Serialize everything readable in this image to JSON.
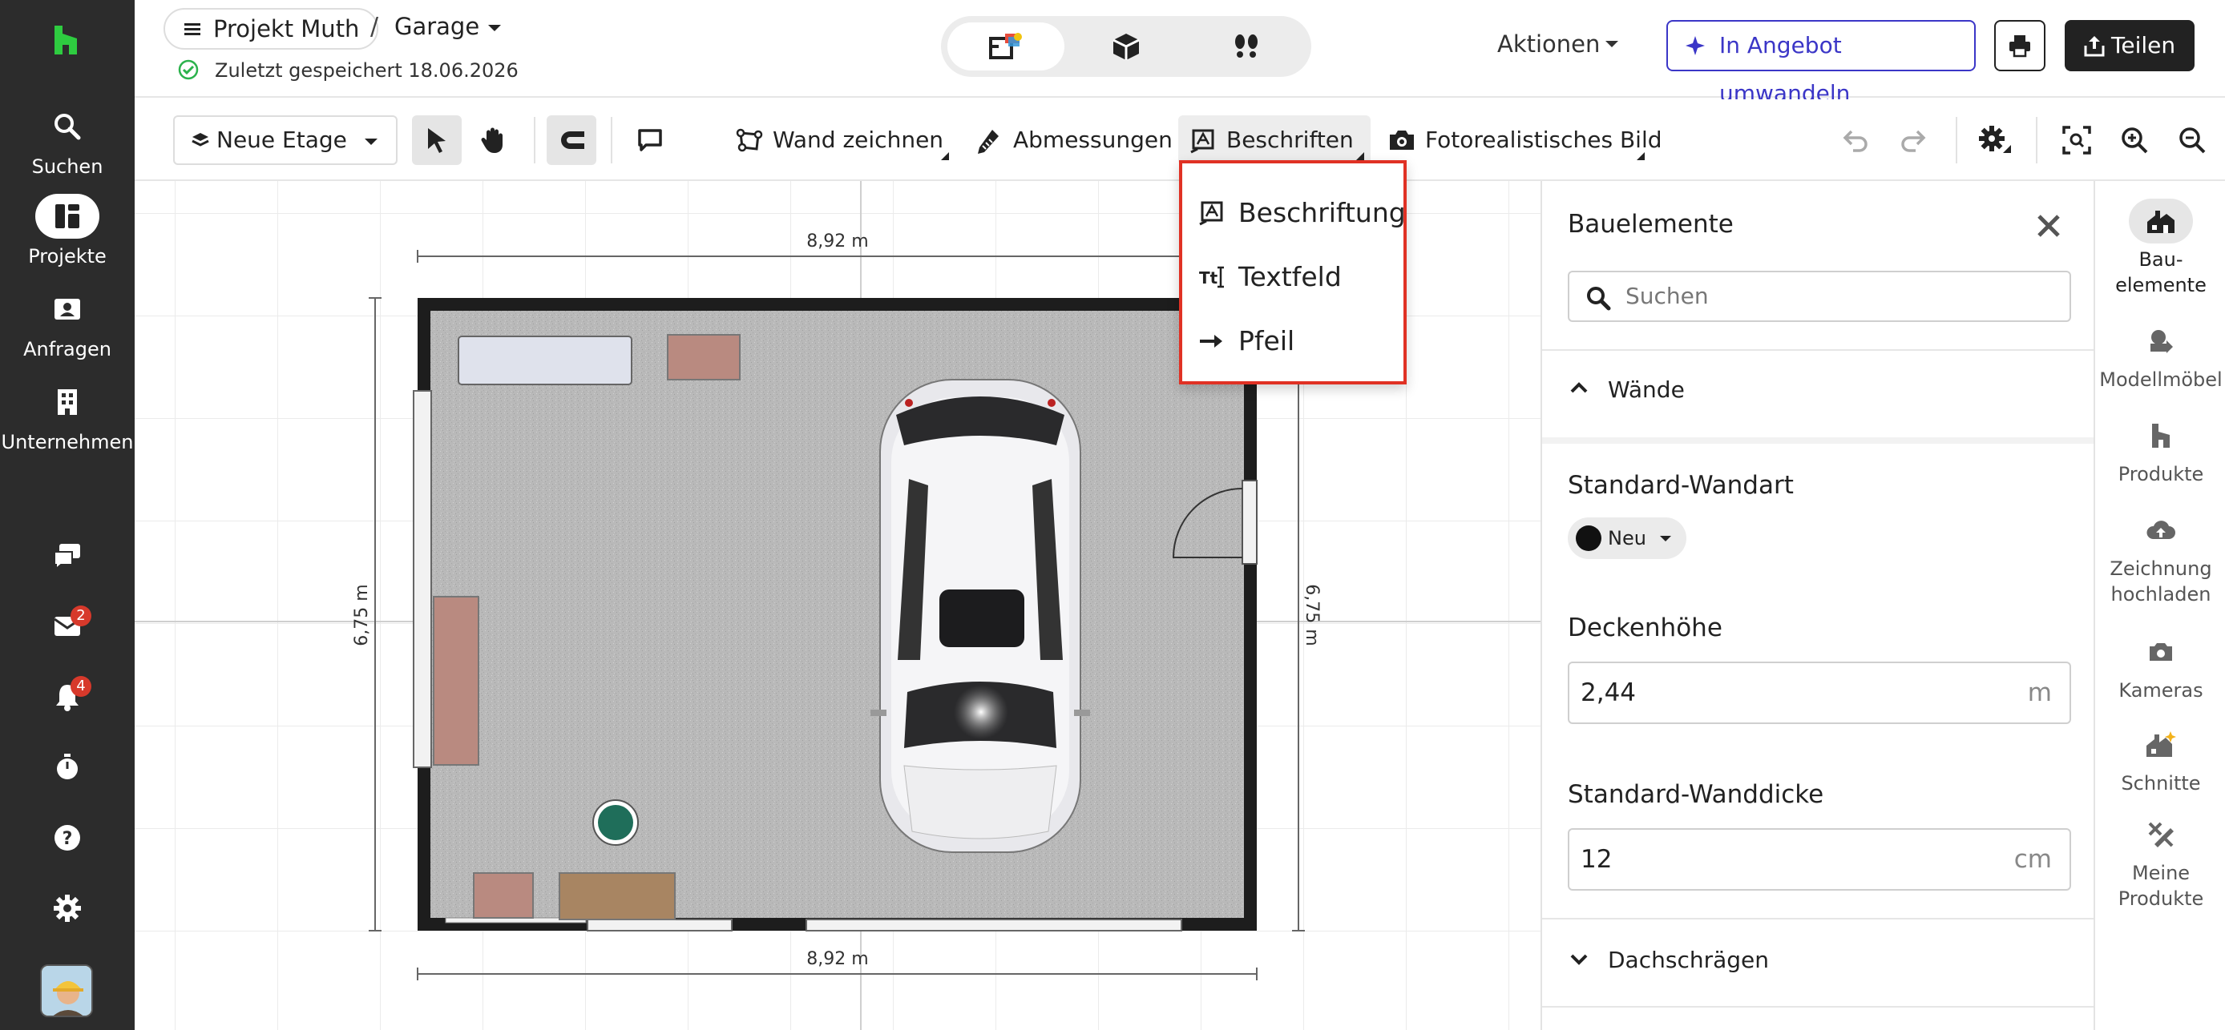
{
  "colors": {
    "nav_bg": "#2c2c2c",
    "logo": "#2ecc40",
    "accent": "#3b36c7",
    "highlight_border": "#e03124",
    "badge": "#d7392b"
  },
  "nav": {
    "logo_icon": "houzz-logo-icon",
    "items": [
      {
        "label": "Suchen",
        "icon": "search-icon"
      },
      {
        "label": "Projekte",
        "icon": "projects-icon"
      },
      {
        "label": "Anfragen",
        "icon": "inquiries-icon"
      },
      {
        "label": "Unternehmen",
        "icon": "company-icon"
      }
    ],
    "bottom": [
      {
        "icon": "chat-icon"
      },
      {
        "icon": "mail-icon",
        "badge": "2"
      },
      {
        "icon": "bell-icon",
        "badge": "4"
      },
      {
        "icon": "timer-icon"
      },
      {
        "icon": "help-icon"
      },
      {
        "icon": "settings-icon"
      }
    ]
  },
  "header": {
    "project": "Projekt Muth",
    "separator": "/",
    "room": "Garage",
    "saved": "Zuletzt gespeichert 18.06.2026",
    "views": [
      "2d-plan-icon",
      "3d-box-icon",
      "walkthrough-icon"
    ],
    "actions_label": "Aktionen",
    "convert_label": "In Angebot umwandeln",
    "share_label": "Teilen"
  },
  "toolbar": {
    "floor_label": "Neue Etage",
    "wall_label": "Wand zeichnen",
    "dimensions_label": "Abmessungen",
    "label_tool": "Beschriften",
    "photo_label": "Fotorealistisches Bild"
  },
  "dropdown": {
    "items": [
      {
        "label": "Beschriftung",
        "icon": "label-icon"
      },
      {
        "label": "Textfeld",
        "icon": "textfield-icon"
      },
      {
        "label": "Pfeil",
        "icon": "arrow-icon"
      }
    ]
  },
  "plan": {
    "dim_top": "8,92 m",
    "dim_bottom": "8,92 m",
    "dim_left": "6,75 m",
    "dim_right": "6,75 m"
  },
  "panel": {
    "title": "Bauelemente",
    "search_placeholder": "Suchen",
    "walls_section": "Wände",
    "wall_type_label": "Standard-Wandart",
    "wall_type_value": "Neu",
    "ceiling_label": "Deckenhöhe",
    "ceiling_value": "2,44",
    "ceiling_unit": "m",
    "thickness_label": "Standard-Wanddicke",
    "thickness_value": "12",
    "thickness_unit": "cm",
    "roof_section": "Dachschrägen"
  },
  "rail": {
    "items": [
      {
        "label": "Bau-\nelemente",
        "icon": "building-elements-icon"
      },
      {
        "label": "Modellmöbel",
        "icon": "model-furniture-icon"
      },
      {
        "label": "Produkte",
        "icon": "products-icon"
      },
      {
        "label": "Zeichnung hochladen",
        "icon": "upload-drawing-icon"
      },
      {
        "label": "Kameras",
        "icon": "camera-icon"
      },
      {
        "label": "Schnitte",
        "icon": "sections-icon"
      },
      {
        "label": "Meine Produkte",
        "icon": "my-products-icon"
      }
    ]
  }
}
